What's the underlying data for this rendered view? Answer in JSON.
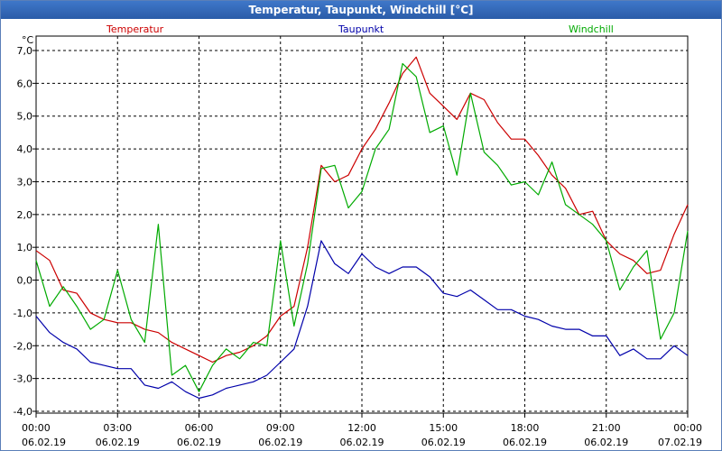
{
  "window": {
    "title": "Temperatur, Taupunkt, Windchill [°C]"
  },
  "chart_data": {
    "type": "line",
    "title": "Temperatur, Taupunkt, Windchill [°C]",
    "ylabel": "°C",
    "ylim": [
      -4,
      7
    ],
    "xlim_hours": [
      0,
      24
    ],
    "grid": true,
    "legend_placement": "top",
    "y_ticks": [
      "7,0",
      "6,0",
      "5,0",
      "4,0",
      "3,0",
      "2,0",
      "1,0",
      "0,0",
      "-1,0",
      "-2,0",
      "-3,0",
      "-4,0"
    ],
    "x_ticks": [
      {
        "time": "00:00",
        "date": "06.02.19"
      },
      {
        "time": "03:00",
        "date": "06.02.19"
      },
      {
        "time": "06:00",
        "date": "06.02.19"
      },
      {
        "time": "09:00",
        "date": "06.02.19"
      },
      {
        "time": "12:00",
        "date": "06.02.19"
      },
      {
        "time": "15:00",
        "date": "06.02.19"
      },
      {
        "time": "18:00",
        "date": "06.02.19"
      },
      {
        "time": "21:00",
        "date": "06.02.19"
      },
      {
        "time": "00:00",
        "date": "07.02.19"
      }
    ],
    "series": [
      {
        "name": "Temperatur",
        "color": "#cc0000",
        "points": [
          [
            0,
            0.9
          ],
          [
            0.5,
            0.6
          ],
          [
            1,
            -0.3
          ],
          [
            1.5,
            -0.4
          ],
          [
            2,
            -1.0
          ],
          [
            2.5,
            -1.2
          ],
          [
            3,
            -1.3
          ],
          [
            3.5,
            -1.3
          ],
          [
            4,
            -1.5
          ],
          [
            4.5,
            -1.6
          ],
          [
            5,
            -1.9
          ],
          [
            5.5,
            -2.1
          ],
          [
            6,
            -2.3
          ],
          [
            6.5,
            -2.5
          ],
          [
            7,
            -2.3
          ],
          [
            7.5,
            -2.2
          ],
          [
            8,
            -2.0
          ],
          [
            8.5,
            -1.7
          ],
          [
            9,
            -1.1
          ],
          [
            9.5,
            -0.8
          ],
          [
            10,
            1.0
          ],
          [
            10.5,
            3.5
          ],
          [
            11,
            3.0
          ],
          [
            11.5,
            3.2
          ],
          [
            12,
            4.0
          ],
          [
            12.5,
            4.6
          ],
          [
            13,
            5.4
          ],
          [
            13.5,
            6.3
          ],
          [
            14,
            6.8
          ],
          [
            14.5,
            5.7
          ],
          [
            15,
            5.3
          ],
          [
            15.5,
            4.9
          ],
          [
            16,
            5.7
          ],
          [
            16.5,
            5.5
          ],
          [
            17,
            4.8
          ],
          [
            17.5,
            4.3
          ],
          [
            18,
            4.3
          ],
          [
            18.5,
            3.8
          ],
          [
            19,
            3.2
          ],
          [
            19.5,
            2.8
          ],
          [
            20,
            2.0
          ],
          [
            20.5,
            2.1
          ],
          [
            21,
            1.2
          ],
          [
            21.5,
            0.8
          ],
          [
            22,
            0.6
          ],
          [
            22.5,
            0.2
          ],
          [
            23,
            0.3
          ],
          [
            23.5,
            1.4
          ],
          [
            24,
            2.3
          ]
        ]
      },
      {
        "name": "Taupunkt",
        "color": "#0000aa",
        "points": [
          [
            0,
            -1.1
          ],
          [
            0.5,
            -1.6
          ],
          [
            1,
            -1.9
          ],
          [
            1.5,
            -2.1
          ],
          [
            2,
            -2.5
          ],
          [
            2.5,
            -2.6
          ],
          [
            3,
            -2.7
          ],
          [
            3.5,
            -2.7
          ],
          [
            4,
            -3.2
          ],
          [
            4.5,
            -3.3
          ],
          [
            5,
            -3.1
          ],
          [
            5.5,
            -3.4
          ],
          [
            6,
            -3.6
          ],
          [
            6.5,
            -3.5
          ],
          [
            7,
            -3.3
          ],
          [
            7.5,
            -3.2
          ],
          [
            8,
            -3.1
          ],
          [
            8.5,
            -2.9
          ],
          [
            9,
            -2.5
          ],
          [
            9.5,
            -2.1
          ],
          [
            10,
            -0.8
          ],
          [
            10.5,
            1.2
          ],
          [
            11,
            0.5
          ],
          [
            11.5,
            0.2
          ],
          [
            12,
            0.8
          ],
          [
            12.5,
            0.4
          ],
          [
            13,
            0.2
          ],
          [
            13.5,
            0.4
          ],
          [
            14,
            0.4
          ],
          [
            14.5,
            0.1
          ],
          [
            15,
            -0.4
          ],
          [
            15.5,
            -0.5
          ],
          [
            16,
            -0.3
          ],
          [
            16.5,
            -0.6
          ],
          [
            17,
            -0.9
          ],
          [
            17.5,
            -0.9
          ],
          [
            18,
            -1.1
          ],
          [
            18.5,
            -1.2
          ],
          [
            19,
            -1.4
          ],
          [
            19.5,
            -1.5
          ],
          [
            20,
            -1.5
          ],
          [
            20.5,
            -1.7
          ],
          [
            21,
            -1.7
          ],
          [
            21.5,
            -2.3
          ],
          [
            22,
            -2.1
          ],
          [
            22.5,
            -2.4
          ],
          [
            23,
            -2.4
          ],
          [
            23.5,
            -2.0
          ],
          [
            24,
            -2.3
          ]
        ]
      },
      {
        "name": "Windchill",
        "color": "#00aa00",
        "points": [
          [
            0,
            0.6
          ],
          [
            0.5,
            -0.8
          ],
          [
            1,
            -0.2
          ],
          [
            1.5,
            -0.8
          ],
          [
            2,
            -1.5
          ],
          [
            2.5,
            -1.2
          ],
          [
            3,
            0.3
          ],
          [
            3.5,
            -1.2
          ],
          [
            4,
            -1.9
          ],
          [
            4.5,
            1.7
          ],
          [
            5,
            -2.9
          ],
          [
            5.5,
            -2.6
          ],
          [
            6,
            -3.4
          ],
          [
            6.5,
            -2.6
          ],
          [
            7,
            -2.1
          ],
          [
            7.5,
            -2.4
          ],
          [
            8,
            -1.9
          ],
          [
            8.5,
            -2.0
          ],
          [
            9,
            1.2
          ],
          [
            9.5,
            -1.4
          ],
          [
            10,
            0.5
          ],
          [
            10.5,
            3.4
          ],
          [
            11,
            3.5
          ],
          [
            11.5,
            2.2
          ],
          [
            12,
            2.7
          ],
          [
            12.5,
            4.0
          ],
          [
            13,
            4.6
          ],
          [
            13.5,
            6.6
          ],
          [
            14,
            6.2
          ],
          [
            14.5,
            4.5
          ],
          [
            15,
            4.7
          ],
          [
            15.5,
            3.2
          ],
          [
            16,
            5.7
          ],
          [
            16.5,
            3.9
          ],
          [
            17,
            3.5
          ],
          [
            17.5,
            2.9
          ],
          [
            18,
            3.0
          ],
          [
            18.5,
            2.6
          ],
          [
            19,
            3.6
          ],
          [
            19.5,
            2.3
          ],
          [
            20,
            2.0
          ],
          [
            20.5,
            1.7
          ],
          [
            21,
            1.2
          ],
          [
            21.5,
            -0.3
          ],
          [
            22,
            0.4
          ],
          [
            22.5,
            0.9
          ],
          [
            23,
            -1.8
          ],
          [
            23.5,
            -1.0
          ],
          [
            24,
            1.5
          ]
        ]
      }
    ]
  }
}
